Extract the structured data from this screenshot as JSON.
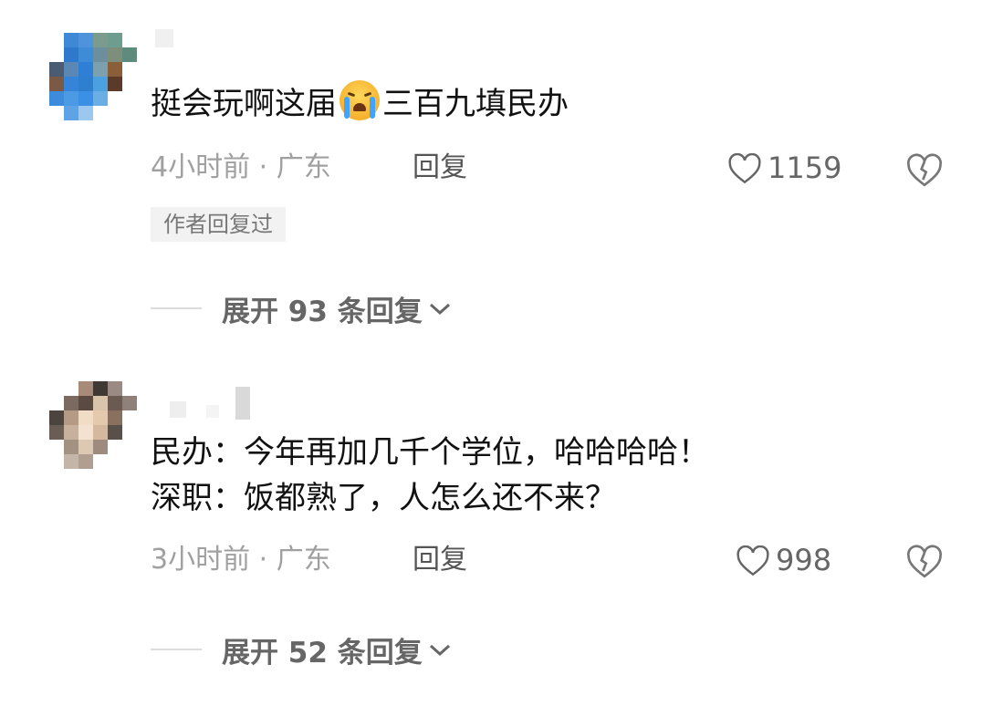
{
  "comments": [
    {
      "lines": [
        "挺会玩啊这届",
        "三百九填民办"
      ],
      "emoji": "crying-face",
      "time_location": "4小时前 · 广东",
      "reply_label": "回复",
      "likes": "1159",
      "badge": "作者回复过",
      "expand_label": "展开 93 条回复"
    },
    {
      "lines": [
        "民办：今年再加几千个学位，哈哈哈哈！",
        "深职：饭都熟了，人怎么还不来？"
      ],
      "time_location": "3小时前 · 广东",
      "reply_label": "回复",
      "likes": "998",
      "expand_label": "展开 52 条回复"
    }
  ],
  "colors": {
    "text": "#111111",
    "meta": "#a0a0a0",
    "expand": "#666666"
  },
  "icons": [
    "heart-outline-icon",
    "broken-heart-icon",
    "chevron-down-icon"
  ]
}
